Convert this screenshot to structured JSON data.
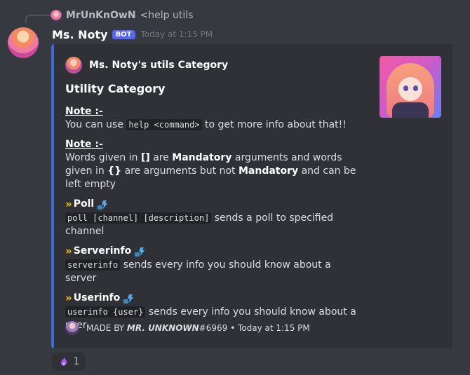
{
  "reply": {
    "username": "MrUnKnOwN",
    "text": "<help utils"
  },
  "message": {
    "username": "Ms. Noty",
    "badge": "BOT",
    "timestamp": "Today at 1:15 PM"
  },
  "embed": {
    "color": "#3a6bd9",
    "author": "Ms. Noty's utils Category",
    "title": "Utility Category",
    "note1_label": "Note :-",
    "note1_pre": "You can use ",
    "note1_code": "help <command>",
    "note1_post": " to get more info about that!!",
    "note2_label": "Note :-",
    "note2_t1": "Words given in ",
    "note2_b1": "[]",
    "note2_t2": " are ",
    "note2_b2": "Mandatory",
    "note2_t3": " arguments and words given in ",
    "note2_b3": "{}",
    "note2_t4": " are arguments but not ",
    "note2_b4": "Mandatory",
    "note2_t5": " and can be left empty",
    "fields": [
      {
        "chevron": "»",
        "name": "Poll",
        "code": "poll [channel] [description]",
        "text": " sends a poll to specified channel"
      },
      {
        "chevron": "»",
        "name": "Serverinfo",
        "code": "serverinfo",
        "text": " sends every info you should know about a server"
      },
      {
        "chevron": "»",
        "name": "Userinfo",
        "code": "userinfo {user}",
        "text": " sends every info you should know about a user"
      }
    ],
    "footer": {
      "prefix": "MADE BY ",
      "name": "MR. UNKNOWN",
      "tag": "#6969",
      "sep": " • ",
      "time": "Today at 1:15 PM"
    }
  },
  "reaction": {
    "icon": "purple-fire-emoji",
    "count": "1"
  }
}
